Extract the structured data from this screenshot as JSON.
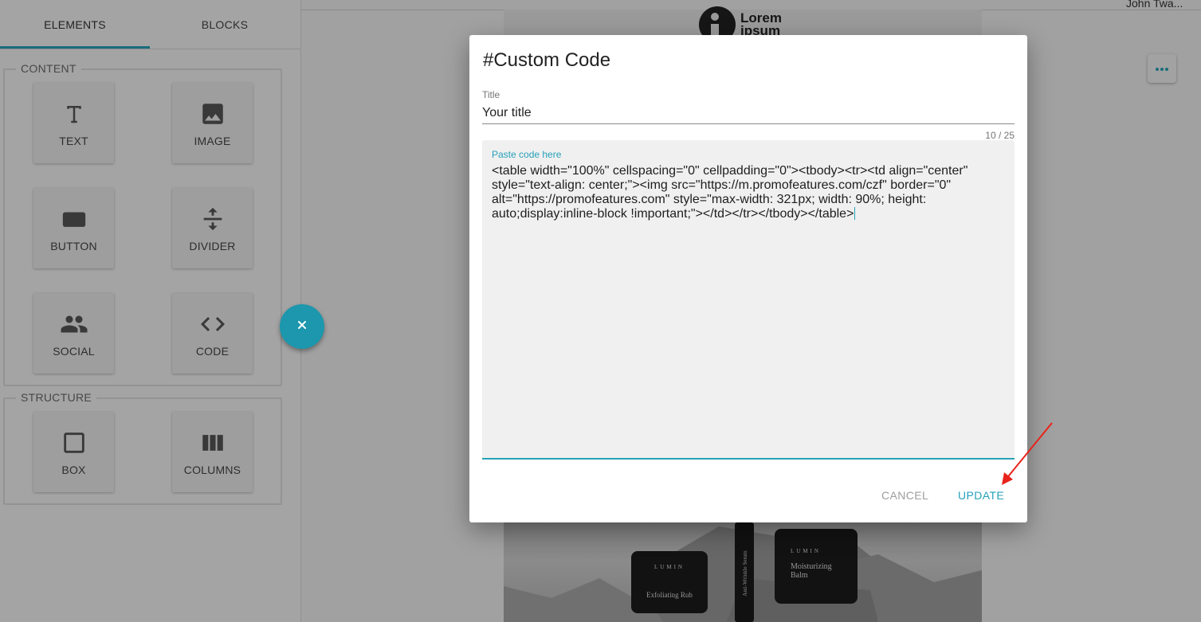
{
  "header": {
    "user_name": "John Twa..."
  },
  "sidebar": {
    "tabs": [
      {
        "label": "ELEMENTS",
        "active": true
      },
      {
        "label": "BLOCKS",
        "active": false
      }
    ],
    "content_group": {
      "legend": "CONTENT",
      "items": [
        {
          "label": "TEXT",
          "icon": "text-icon"
        },
        {
          "label": "IMAGE",
          "icon": "image-icon"
        },
        {
          "label": "BUTTON",
          "icon": "button-icon"
        },
        {
          "label": "DIVIDER",
          "icon": "divider-icon"
        },
        {
          "label": "SOCIAL",
          "icon": "social-icon"
        },
        {
          "label": "CODE",
          "icon": "code-icon"
        }
      ]
    },
    "structure_group": {
      "legend": "STRUCTURE",
      "items": [
        {
          "label": "BOX",
          "icon": "box-icon"
        },
        {
          "label": "COLUMNS",
          "icon": "columns-icon"
        }
      ]
    }
  },
  "canvas": {
    "logo_text_line1": "Lorem",
    "logo_text_line2": "ipsum",
    "products": [
      {
        "brand": "LUMIN",
        "name": "Exfoliating Rub"
      },
      {
        "brand": "LUMIN",
        "name": "Moisturizing Balm"
      },
      {
        "name": "Anti-Wrinkle Serum"
      }
    ]
  },
  "dialog": {
    "title": "#Custom Code",
    "title_field": {
      "label": "Title",
      "value": "Your title",
      "counter": "10 / 25"
    },
    "code_field": {
      "label": "Paste code here",
      "value": "<table width=\"100%\" cellspacing=\"0\" cellpadding=\"0\"><tbody><tr><td align=\"center\" style=\"text-align: center;\"><img src=\"https://m.promofeatures.com/czf\" border=\"0\" alt=\"https://promofeatures.com\" style=\"max-width: 321px; width: 90%; height: auto;display:inline-block !important;\"></td></tr></tbody></table>"
    },
    "cancel_label": "CANCEL",
    "update_label": "UPDATE"
  },
  "colors": {
    "accent": "#26a1b8",
    "fab": "#1c97ad",
    "annotation_arrow": "#e8231b"
  }
}
